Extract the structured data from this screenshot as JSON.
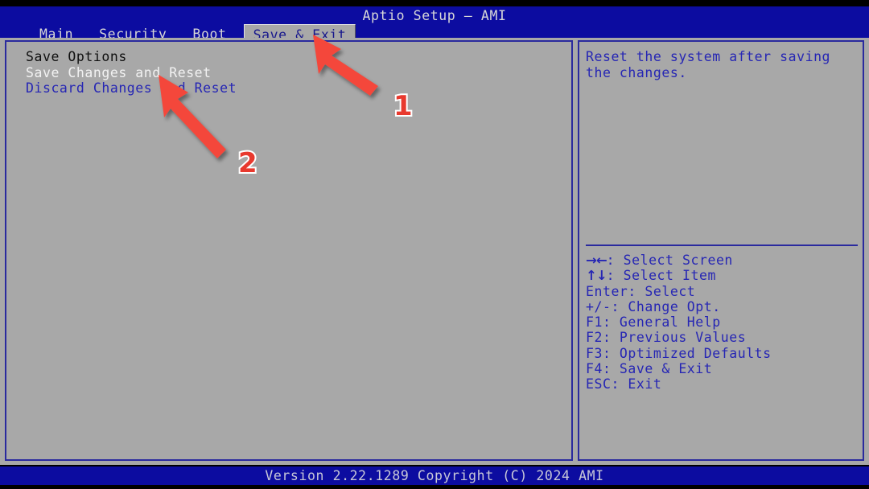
{
  "window": {
    "title": "Aptio Setup – AMI",
    "colors": {
      "header_blue": "#0c0ca0",
      "panel_gray": "#a8a8a8",
      "border_blue": "#2a2a9e",
      "text_blue": "#2626b4",
      "selected_text": "#f2f2f2",
      "annotation_red": "#e8392e"
    }
  },
  "menu": {
    "tabs": [
      {
        "label": "Main",
        "active": false
      },
      {
        "label": "Security",
        "active": false
      },
      {
        "label": "Boot",
        "active": false
      },
      {
        "label": "Save & Exit",
        "active": true
      }
    ]
  },
  "main_panel": {
    "section_header": "Save Options",
    "options": [
      {
        "label": "Save Changes and Reset",
        "state": "selected"
      },
      {
        "label": "Discard Changes and Reset",
        "state": "normal"
      }
    ]
  },
  "help_panel": {
    "description_lines": [
      "Reset the system after saving",
      "the changes."
    ],
    "key_legend": [
      {
        "glyph": "→←",
        "text": ": Select Screen"
      },
      {
        "glyph": "↑↓",
        "text": ": Select Item"
      },
      {
        "glyph": "",
        "text": "Enter: Select"
      },
      {
        "glyph": "",
        "text": "+/-: Change Opt."
      },
      {
        "glyph": "",
        "text": "F1: General Help"
      },
      {
        "glyph": "",
        "text": "F2: Previous Values"
      },
      {
        "glyph": "",
        "text": "F3: Optimized Defaults"
      },
      {
        "glyph": "",
        "text": "F4: Save & Exit"
      },
      {
        "glyph": "",
        "text": "ESC: Exit"
      }
    ]
  },
  "status_bar": {
    "version_text": "Version 2.22.1289 Copyright (C) 2024 AMI"
  },
  "annotations": [
    {
      "number": "1",
      "target": "Save & Exit tab"
    },
    {
      "number": "2",
      "target": "Save Changes and Reset option"
    }
  ]
}
